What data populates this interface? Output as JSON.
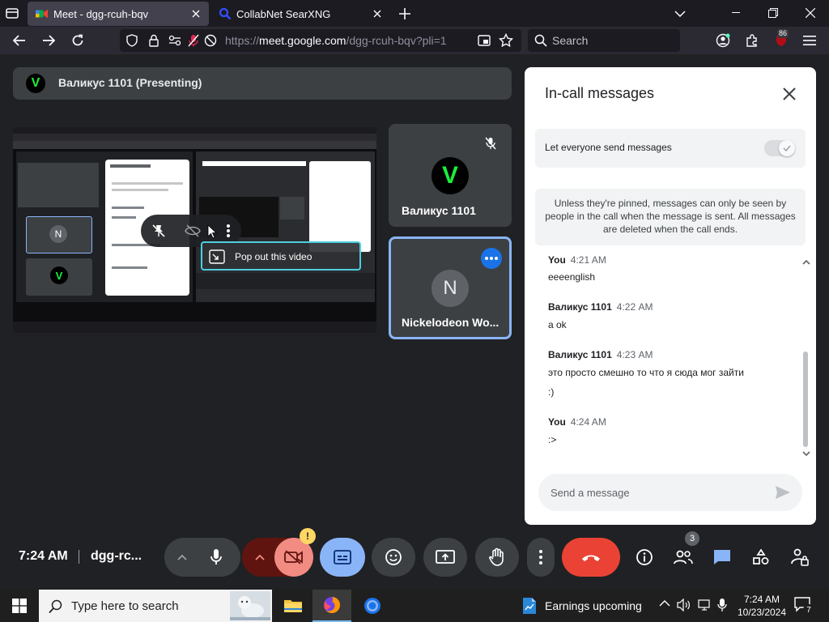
{
  "browser": {
    "tabs": [
      {
        "title": "Meet - dgg-rcuh-bqv",
        "active": true
      },
      {
        "title": "CollabNet SearXNG",
        "active": false
      }
    ],
    "url_prefix": "https://",
    "url_host": "meet.google.com",
    "url_path": "/dgg-rcuh-bqv?pli=1",
    "search_placeholder": "Search",
    "extension_badge": "86"
  },
  "meet": {
    "presenting_label": "Валикус 1101 (Presenting)",
    "popout_label": "Pop out this video",
    "participants": [
      {
        "name": "Валикус 1101",
        "avatar": "V",
        "muted": true
      },
      {
        "name": "Nickelodeon Wo...",
        "avatar": "N",
        "muted": false
      }
    ],
    "time": "7:24 AM",
    "meeting_code": "dgg-rc...",
    "people_count": "3",
    "camera_alert": "!"
  },
  "chat": {
    "title": "In-call messages",
    "permission_label": "Let everyone send messages",
    "notice": "Unless they're pinned, messages can only be seen by people in the call when the message is sent. All messages are deleted when the call ends.",
    "messages": [
      {
        "sender": "You",
        "time": "4:21 AM",
        "lines": [
          "eeeenglish"
        ]
      },
      {
        "sender": "Валикус 1101",
        "time": "4:22 AM",
        "lines": [
          "a ok"
        ]
      },
      {
        "sender": "Валикус 1101",
        "time": "4:23 AM",
        "lines": [
          "это просто смешно то что я сюда мог зайти",
          ":)"
        ]
      },
      {
        "sender": "You",
        "time": "4:24 AM",
        "lines": [
          ":>"
        ]
      }
    ],
    "composer_placeholder": "Send a message"
  },
  "taskbar": {
    "search_placeholder": "Type here to search",
    "news_label": "Earnings upcoming",
    "clock_time": "7:24 AM",
    "clock_date": "10/23/2024",
    "notification_count": "7"
  },
  "colors": {
    "meet_bg": "#202124",
    "tile_bg": "#3c4043",
    "accent_blue": "#8ab4f8",
    "end_call_red": "#ea4335",
    "captions_active": "#8ab4f8",
    "camera_off_bg": "#f28b82"
  }
}
